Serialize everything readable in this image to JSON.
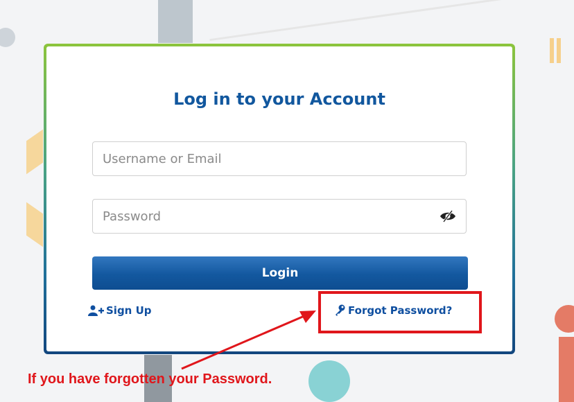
{
  "login_card": {
    "title": "Log in to your Account",
    "username_placeholder": "Username or Email",
    "password_placeholder": "Password",
    "login_label": "Login",
    "signup_label": "Sign Up",
    "forgot_label": "Forgot Password?"
  },
  "annotation": {
    "caption": "If you have forgotten your Password.",
    "color": "#e0161b"
  },
  "colors": {
    "brand_blue": "#11579e",
    "button_blue": "#13589f",
    "frame_green": "#8cc43c"
  },
  "icons": [
    "eye-slash-icon",
    "user-plus-icon",
    "key-icon",
    "arrow-icon"
  ]
}
